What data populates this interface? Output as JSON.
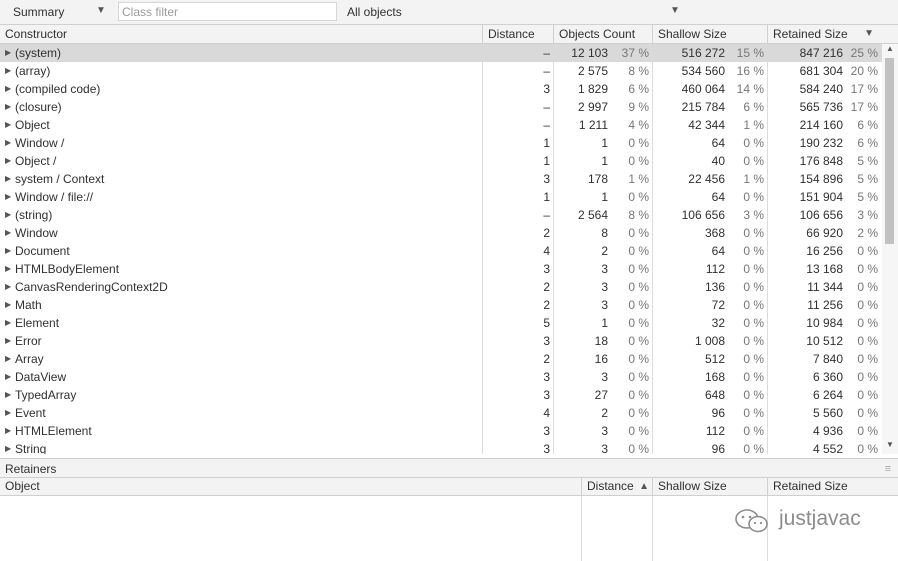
{
  "toolbar": {
    "view": "Summary",
    "filter_placeholder": "Class filter",
    "filter_value": "",
    "objects": "All objects"
  },
  "columns": {
    "constructor": "Constructor",
    "distance": "Distance",
    "objects_count": "Objects Count",
    "shallow_size": "Shallow Size",
    "retained_size": "Retained Size"
  },
  "rows": [
    {
      "name": "(system)",
      "distance": "–",
      "count": "12 103",
      "count_pct": "37 %",
      "shallow": "516 272",
      "shallow_pct": "15 %",
      "retained": "847 216",
      "retained_pct": "25 %"
    },
    {
      "name": "(array)",
      "distance": "–",
      "count": "2 575",
      "count_pct": "8 %",
      "shallow": "534 560",
      "shallow_pct": "16 %",
      "retained": "681 304",
      "retained_pct": "20 %"
    },
    {
      "name": "(compiled code)",
      "distance": "3",
      "count": "1 829",
      "count_pct": "6 %",
      "shallow": "460 064",
      "shallow_pct": "14 %",
      "retained": "584 240",
      "retained_pct": "17 %"
    },
    {
      "name": "(closure)",
      "distance": "–",
      "count": "2 997",
      "count_pct": "9 %",
      "shallow": "215 784",
      "shallow_pct": "6 %",
      "retained": "565 736",
      "retained_pct": "17 %"
    },
    {
      "name": "Object",
      "distance": "–",
      "count": "1 211",
      "count_pct": "4 %",
      "shallow": "42 344",
      "shallow_pct": "1 %",
      "retained": "214 160",
      "retained_pct": "6 %"
    },
    {
      "name": "Window /",
      "distance": "1",
      "count": "1",
      "count_pct": "0 %",
      "shallow": "64",
      "shallow_pct": "0 %",
      "retained": "190 232",
      "retained_pct": "6 %"
    },
    {
      "name": "Object /",
      "distance": "1",
      "count": "1",
      "count_pct": "0 %",
      "shallow": "40",
      "shallow_pct": "0 %",
      "retained": "176 848",
      "retained_pct": "5 %"
    },
    {
      "name": "system / Context",
      "distance": "3",
      "count": "178",
      "count_pct": "1 %",
      "shallow": "22 456",
      "shallow_pct": "1 %",
      "retained": "154 896",
      "retained_pct": "5 %"
    },
    {
      "name": "Window / file://",
      "distance": "1",
      "count": "1",
      "count_pct": "0 %",
      "shallow": "64",
      "shallow_pct": "0 %",
      "retained": "151 904",
      "retained_pct": "5 %"
    },
    {
      "name": "(string)",
      "distance": "–",
      "count": "2 564",
      "count_pct": "8 %",
      "shallow": "106 656",
      "shallow_pct": "3 %",
      "retained": "106 656",
      "retained_pct": "3 %"
    },
    {
      "name": "Window",
      "distance": "2",
      "count": "8",
      "count_pct": "0 %",
      "shallow": "368",
      "shallow_pct": "0 %",
      "retained": "66 920",
      "retained_pct": "2 %"
    },
    {
      "name": "Document",
      "distance": "4",
      "count": "2",
      "count_pct": "0 %",
      "shallow": "64",
      "shallow_pct": "0 %",
      "retained": "16 256",
      "retained_pct": "0 %"
    },
    {
      "name": "HTMLBodyElement",
      "distance": "3",
      "count": "3",
      "count_pct": "0 %",
      "shallow": "112",
      "shallow_pct": "0 %",
      "retained": "13 168",
      "retained_pct": "0 %"
    },
    {
      "name": "CanvasRenderingContext2D",
      "distance": "2",
      "count": "3",
      "count_pct": "0 %",
      "shallow": "136",
      "shallow_pct": "0 %",
      "retained": "11 344",
      "retained_pct": "0 %"
    },
    {
      "name": "Math",
      "distance": "2",
      "count": "3",
      "count_pct": "0 %",
      "shallow": "72",
      "shallow_pct": "0 %",
      "retained": "11 256",
      "retained_pct": "0 %"
    },
    {
      "name": "Element",
      "distance": "5",
      "count": "1",
      "count_pct": "0 %",
      "shallow": "32",
      "shallow_pct": "0 %",
      "retained": "10 984",
      "retained_pct": "0 %"
    },
    {
      "name": "Error",
      "distance": "3",
      "count": "18",
      "count_pct": "0 %",
      "shallow": "1 008",
      "shallow_pct": "0 %",
      "retained": "10 512",
      "retained_pct": "0 %"
    },
    {
      "name": "Array",
      "distance": "2",
      "count": "16",
      "count_pct": "0 %",
      "shallow": "512",
      "shallow_pct": "0 %",
      "retained": "7 840",
      "retained_pct": "0 %"
    },
    {
      "name": "DataView",
      "distance": "3",
      "count": "3",
      "count_pct": "0 %",
      "shallow": "168",
      "shallow_pct": "0 %",
      "retained": "6 360",
      "retained_pct": "0 %"
    },
    {
      "name": "TypedArray",
      "distance": "3",
      "count": "27",
      "count_pct": "0 %",
      "shallow": "648",
      "shallow_pct": "0 %",
      "retained": "6 264",
      "retained_pct": "0 %"
    },
    {
      "name": "Event",
      "distance": "4",
      "count": "2",
      "count_pct": "0 %",
      "shallow": "96",
      "shallow_pct": "0 %",
      "retained": "5 560",
      "retained_pct": "0 %"
    },
    {
      "name": "HTMLElement",
      "distance": "3",
      "count": "3",
      "count_pct": "0 %",
      "shallow": "112",
      "shallow_pct": "0 %",
      "retained": "4 936",
      "retained_pct": "0 %"
    },
    {
      "name": "String",
      "distance": "3",
      "count": "3",
      "count_pct": "0 %",
      "shallow": "96",
      "shallow_pct": "0 %",
      "retained": "4 552",
      "retained_pct": "0 %"
    }
  ],
  "retainers": {
    "title": "Retainers",
    "columns": {
      "object": "Object",
      "distance": "Distance",
      "shallow_size": "Shallow Size",
      "retained_size": "Retained Size"
    }
  },
  "watermark": {
    "text": "justjavac"
  },
  "icons": {
    "view_dropdown": "dropdown-arrow-icon",
    "objects_dropdown": "dropdown-arrow-icon",
    "sort": "sort-descending-icon",
    "row_expand": "expand-triangle-icon",
    "retainers_menu": "menu-icon",
    "watermark": "wechat-icon"
  }
}
